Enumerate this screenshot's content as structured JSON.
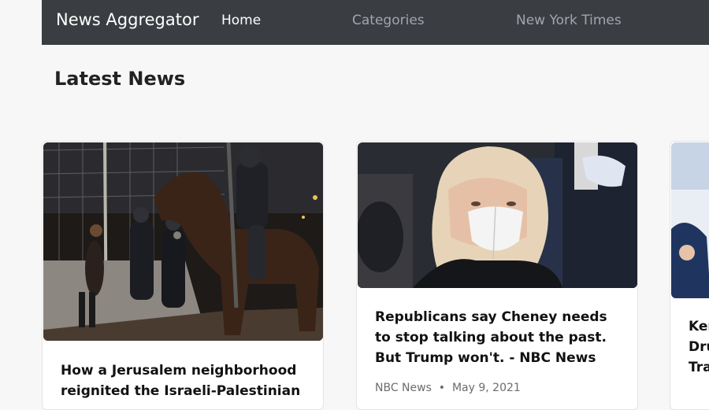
{
  "navbar": {
    "brand": "News Aggregator",
    "links": [
      {
        "label": "Home",
        "active": true
      },
      {
        "label": "Categories",
        "active": false
      },
      {
        "label": "New York Times",
        "active": false
      }
    ]
  },
  "page": {
    "title": "Latest News"
  },
  "articles": [
    {
      "title": "How a Jerusalem neighborhood reignited the Israeli-Palestinian",
      "source": "",
      "date": "",
      "image": "police-horse-street-photo"
    },
    {
      "title": "Republicans say Cheney needs to stop talking about the past. But Trump won't. - NBC News",
      "source": "NBC News",
      "date": "May 9, 2021",
      "image": "woman-white-mask-photo"
    },
    {
      "title": "Ker Dru Tra",
      "source": "",
      "date": "",
      "image": "partial-photo"
    }
  ],
  "colors": {
    "navbar_bg": "#3a3d42",
    "nav_active": "#ffffff",
    "nav_muted": "#a2a6ac",
    "page_bg": "#f7f7f7"
  }
}
